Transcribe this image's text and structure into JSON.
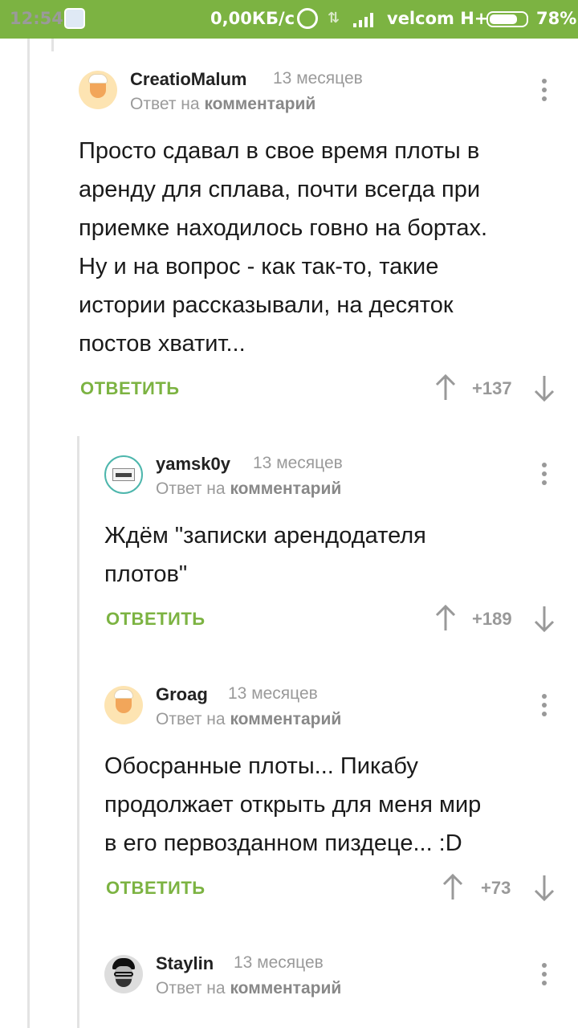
{
  "status_bar": {
    "time": "12:54",
    "network_speed": "0,00КБ/с",
    "carrier": "velcom H+",
    "battery": "78%",
    "battery_level": 0.78
  },
  "comments": [
    {
      "author": "CreatioMalum",
      "time": "13 месяцев",
      "reply_prefix": "Ответ на",
      "reply_target": "комментарий",
      "body": "Просто сдавал в свое время плоты в\nаренду для сплава, почти всегда при\nприемке находилось говно на бортах.\nНу и на вопрос - как так-то, такие\nистории рассказывали, на десяток\nпостов хватит...",
      "reply_label": "ОТВЕТИТЬ",
      "rating": "+137",
      "avatar": "default-chef-avatar"
    },
    {
      "author": "yamsk0y",
      "time": "13 месяцев",
      "reply_prefix": "Ответ на",
      "reply_target": "комментарий",
      "body": "Ждём \"записки арендодателя\nплотов\"",
      "reply_label": "ОТВЕТИТЬ",
      "rating": "+189",
      "avatar": "device-avatar"
    },
    {
      "author": "Groag",
      "time": "13 месяцев",
      "reply_prefix": "Ответ на",
      "reply_target": "комментарий",
      "body": "Обосранные плоты... Пикабу\nпродолжает открыть для меня мир\nв его первозданном пиздеце... :D",
      "reply_label": "ОТВЕТИТЬ",
      "rating": "+73",
      "avatar": "default-chef-avatar"
    },
    {
      "author": "Staylin",
      "time": "13 месяцев",
      "reply_prefix": "Ответ на",
      "reply_target": "комментарий",
      "avatar": "photo-avatar"
    }
  ],
  "colors": {
    "status_bar": "#7cb342",
    "accent": "#7cb342",
    "muted": "#9a9a9a"
  }
}
